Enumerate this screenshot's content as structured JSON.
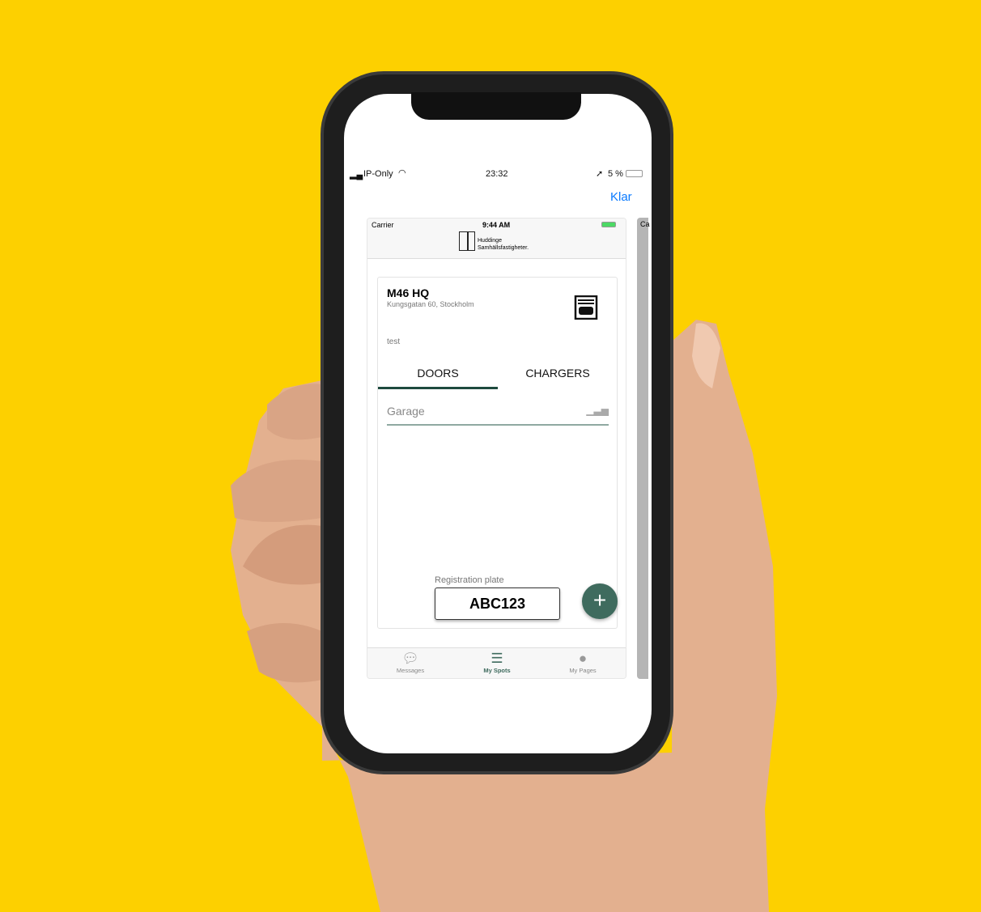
{
  "outer_status": {
    "carrier": "IP-Only",
    "time": "23:32",
    "battery": "5 %"
  },
  "nav": {
    "done": "Klar"
  },
  "inner_status": {
    "carrier": "Carrier",
    "time": "9:44 AM"
  },
  "logo": {
    "line1": "Huddinge",
    "line2": "Samhällsfastigheter."
  },
  "site": {
    "name": "M46 HQ",
    "address": "Kungsgatan 60,  Stockholm",
    "note": "test"
  },
  "tabs": [
    {
      "label": "DOORS",
      "active": true
    },
    {
      "label": "CHARGERS",
      "active": false
    }
  ],
  "door": {
    "name": "Garage"
  },
  "plate": {
    "label": "Registration plate",
    "value": "ABC123"
  },
  "tabbar": [
    {
      "label": "Messages",
      "icon": "chat-icon"
    },
    {
      "label": "My Spots",
      "icon": "spots-icon",
      "active": true
    },
    {
      "label": "My Pages",
      "icon": "person-icon"
    }
  ],
  "side_peek": "Ca",
  "colors": {
    "background": "#FDD000",
    "accent": "#3F6B5E",
    "link": "#0A7AFF"
  }
}
